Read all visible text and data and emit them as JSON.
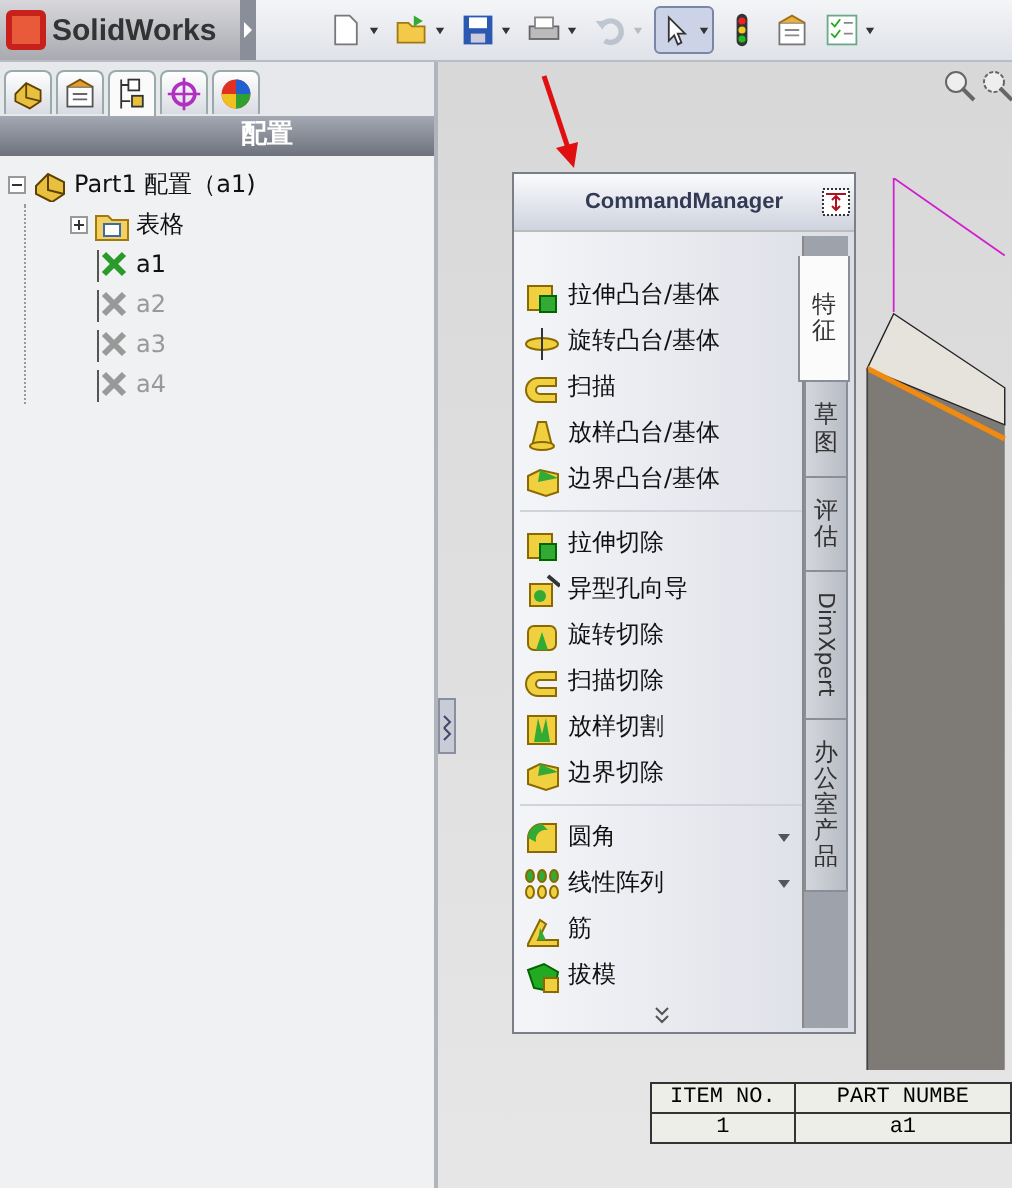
{
  "app": {
    "title": "SolidWorks"
  },
  "toolbar": [
    {
      "kind": "new",
      "dropdown": true,
      "disabled": false,
      "pressed": false
    },
    {
      "kind": "open",
      "dropdown": true,
      "disabled": false,
      "pressed": false
    },
    {
      "kind": "save",
      "dropdown": true,
      "disabled": false,
      "pressed": false
    },
    {
      "kind": "print",
      "dropdown": true,
      "disabled": false,
      "pressed": false
    },
    {
      "kind": "undo",
      "dropdown": true,
      "disabled": true,
      "pressed": false
    },
    {
      "kind": "select",
      "dropdown": true,
      "disabled": false,
      "pressed": true
    },
    {
      "kind": "rebuild",
      "dropdown": false,
      "disabled": false,
      "pressed": false
    },
    {
      "kind": "options",
      "dropdown": false,
      "disabled": false,
      "pressed": false
    },
    {
      "kind": "checklist",
      "dropdown": true,
      "disabled": false,
      "pressed": false
    }
  ],
  "panel_tabs": [
    {
      "kind": "feature",
      "selected": false
    },
    {
      "kind": "property",
      "selected": false
    },
    {
      "kind": "config",
      "selected": true
    },
    {
      "kind": "dim",
      "selected": false
    },
    {
      "kind": "display",
      "selected": false
    }
  ],
  "panel_title": "配置",
  "tree": [
    {
      "label": "Part1 配置（a1)",
      "kind": "part",
      "expanded": true,
      "active": true,
      "children": [
        {
          "label": "表格",
          "kind": "folder",
          "expanded": false,
          "active": true
        },
        {
          "label": "a1",
          "kind": "config",
          "active": true
        },
        {
          "label": "a2",
          "kind": "config",
          "active": false
        },
        {
          "label": "a3",
          "kind": "config",
          "active": false
        },
        {
          "label": "a4",
          "kind": "config",
          "active": false
        }
      ]
    }
  ],
  "command_manager": {
    "title": "CommandManager",
    "groups": [
      [
        {
          "label": "拉伸凸台/基体",
          "has_menu": false
        },
        {
          "label": "旋转凸台/基体",
          "has_menu": false
        },
        {
          "label": "扫描",
          "has_menu": false
        },
        {
          "label": "放样凸台/基体",
          "has_menu": false
        },
        {
          "label": "边界凸台/基体",
          "has_menu": false
        }
      ],
      [
        {
          "label": "拉伸切除",
          "has_menu": false
        },
        {
          "label": "异型孔向导",
          "has_menu": false
        },
        {
          "label": "旋转切除",
          "has_menu": false
        },
        {
          "label": "扫描切除",
          "has_menu": false
        },
        {
          "label": "放样切割",
          "has_menu": false
        },
        {
          "label": "边界切除",
          "has_menu": false
        }
      ],
      [
        {
          "label": "圆角",
          "has_menu": true
        },
        {
          "label": "线性阵列",
          "has_menu": true
        },
        {
          "label": "筋",
          "has_menu": false
        },
        {
          "label": "拔模",
          "has_menu": false
        }
      ]
    ],
    "tabs": [
      {
        "label": "特征",
        "selected": true,
        "kind": "stacked"
      },
      {
        "label": "草图",
        "selected": false,
        "kind": "stacked"
      },
      {
        "label": "评估",
        "selected": false,
        "kind": "stacked"
      },
      {
        "label": "DimXpert",
        "selected": false,
        "kind": "rotated"
      },
      {
        "label": "办公室产品",
        "selected": false,
        "kind": "stacked"
      }
    ]
  },
  "bom_table": {
    "columns": [
      "ITEM NO.",
      "PART NUMBE"
    ],
    "rows": [
      [
        "1",
        "a1"
      ]
    ]
  }
}
